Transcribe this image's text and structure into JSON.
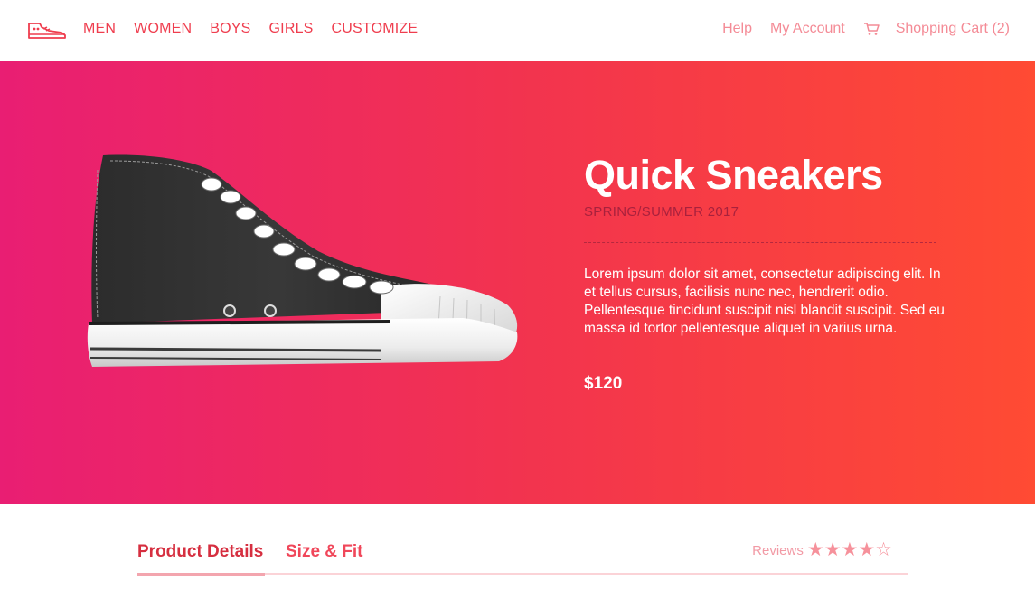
{
  "nav": {
    "logo_icon": "sneaker-logo-icon",
    "links": [
      "MEN",
      "WOMEN",
      "BOYS",
      "GIRLS",
      "CUSTOMIZE"
    ],
    "help": "Help",
    "account": "My Account",
    "cart_icon": "cart-icon",
    "cart": "Shopping Cart (2)"
  },
  "hero": {
    "title": "Quick Sneakers",
    "season": "SPRING/SUMMER 2017",
    "description": "Lorem ipsum dolor sit amet, consectetur adipiscing elit. In et tellus cursus, facilisis nunc nec, hendrerit odio. Pellentesque tincidunt suscipit nisl blandit suscipit. Sed eu massa id tortor pellentesque aliquet in varius urna.",
    "price": "$120",
    "image_icon": "high-top-sneaker-image"
  },
  "tabs": {
    "details": "Product Details",
    "size": "Size & Fit",
    "reviews_label": "Reviews",
    "rating": 4,
    "rating_max": 5
  },
  "colors": {
    "accent": "#ef3d4e",
    "gradient_start": "#e91e73",
    "gradient_end": "#ff4b33"
  }
}
